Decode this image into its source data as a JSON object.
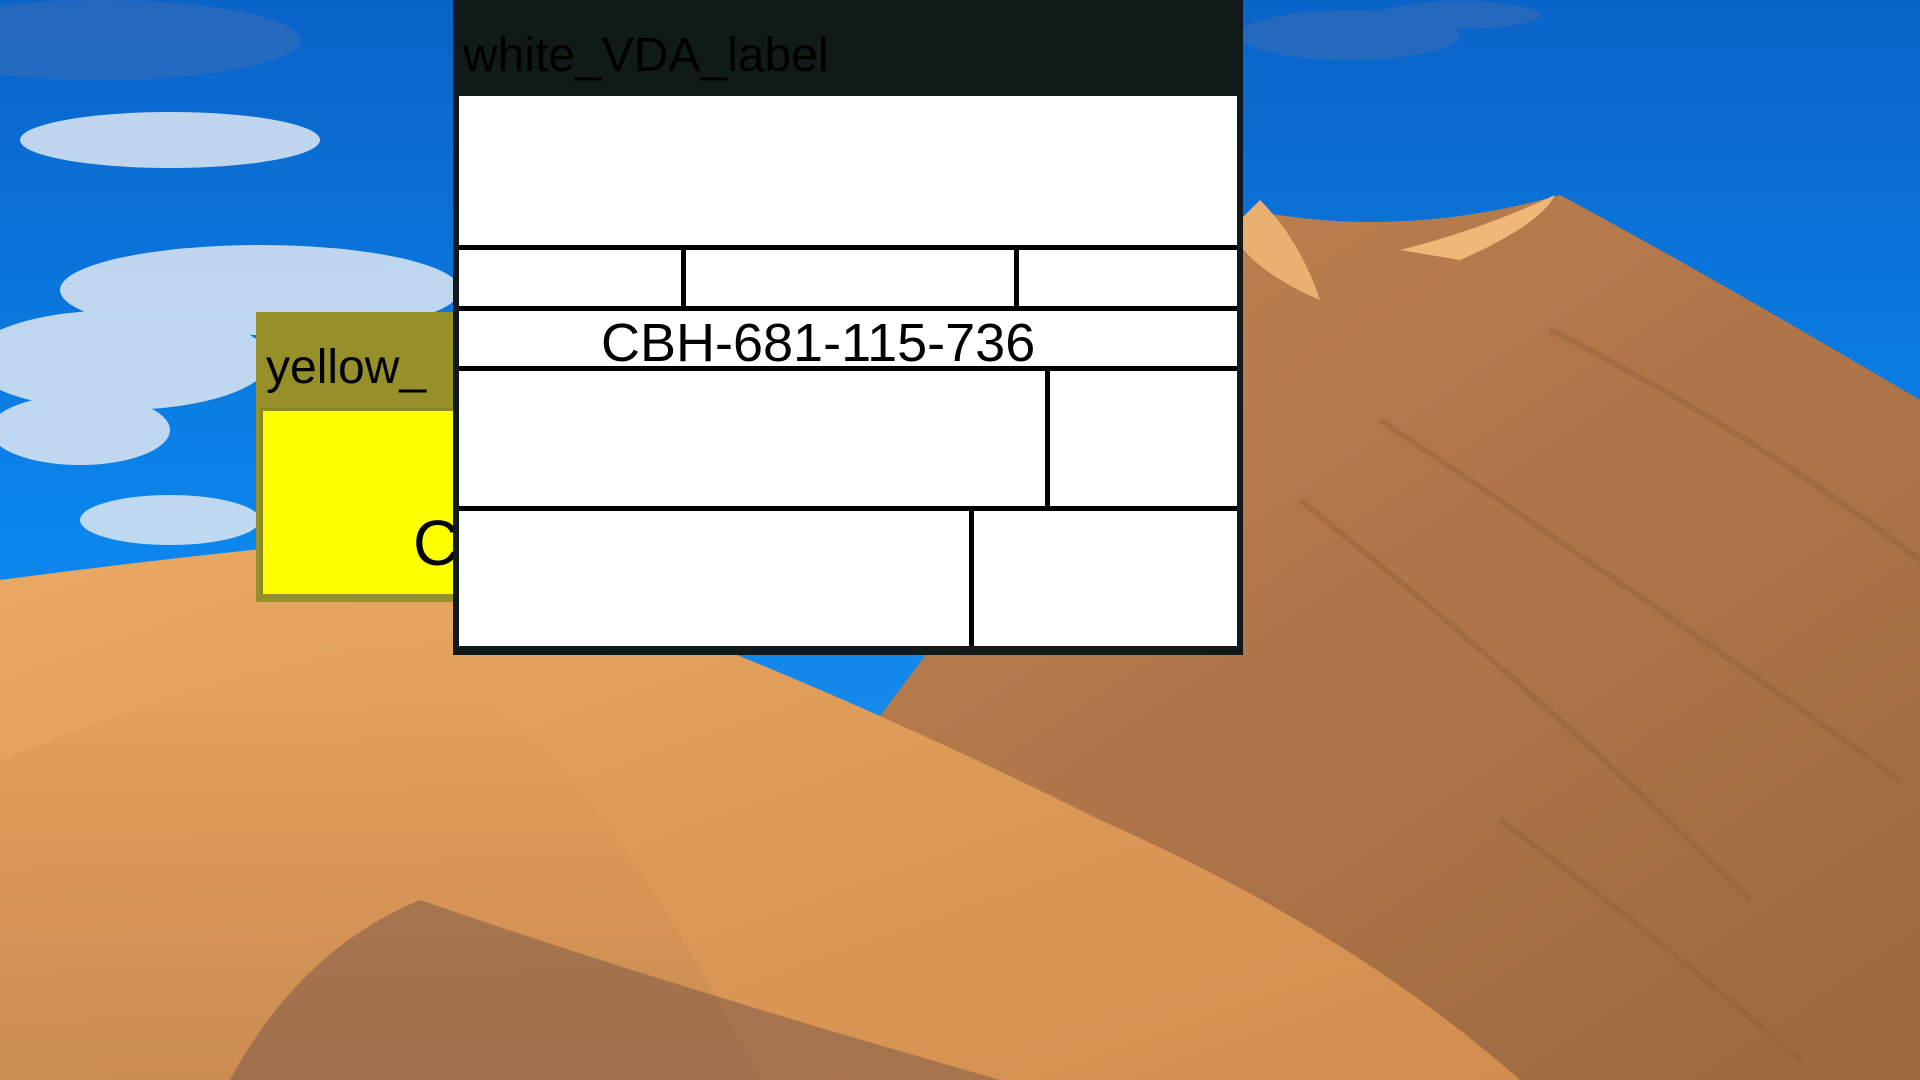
{
  "windows": {
    "yellow": {
      "title": "yellow_",
      "partial_text": "C"
    },
    "white": {
      "title": "white_VDA_label",
      "barcode_text": "CBH-681-115-736"
    }
  },
  "colors": {
    "yellow_frame": "#97902a",
    "yellow_body": "#ffff00",
    "white_frame": "#111a1a",
    "label_bg": "#ffffff"
  },
  "wallpaper": "desert-dunes-blue-sky"
}
